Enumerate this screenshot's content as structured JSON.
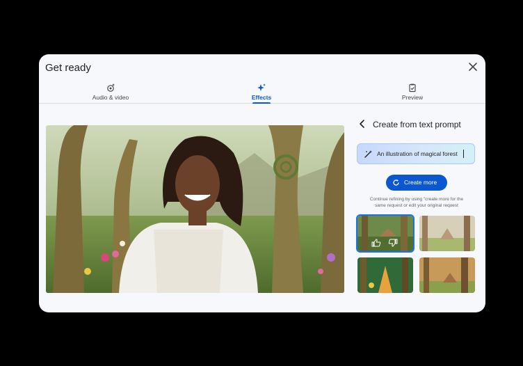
{
  "dialog": {
    "title": "Get ready"
  },
  "tabs": [
    {
      "label": "Audio & video",
      "icon": "settings-sparkle-icon",
      "active": false
    },
    {
      "label": "Effects",
      "icon": "sparkle-icon",
      "active": true
    },
    {
      "label": "Preview",
      "icon": "clipboard-check-icon",
      "active": false
    }
  ],
  "panel": {
    "title": "Create from text prompt",
    "prompt_value": "An illustration of magical forest",
    "create_more_label": "Create more",
    "hint_line1": "Continue refining by using \"create more for the",
    "hint_line2": "same request or edit your original request"
  },
  "colors": {
    "accent": "#0b57d0",
    "selected_outline": "#1a73e8",
    "background": "#f6f8fc"
  }
}
